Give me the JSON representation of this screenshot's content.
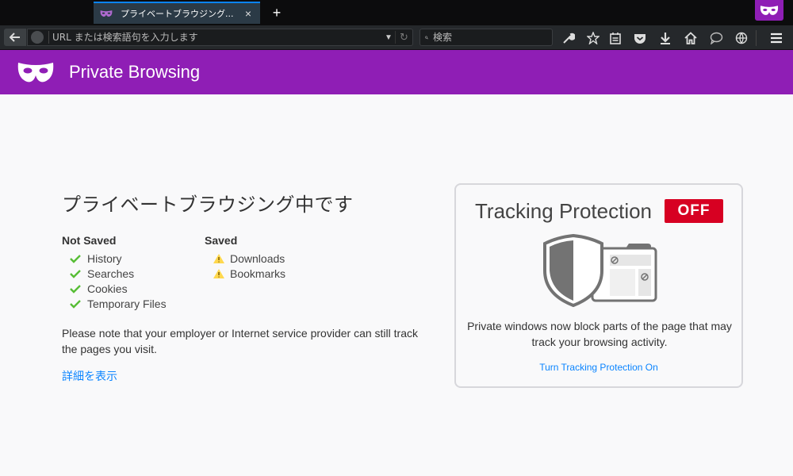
{
  "tab": {
    "title": "プライベートブラウジング...",
    "close_label": "×",
    "newtab_label": "+"
  },
  "navbar": {
    "url_placeholder": "URL または検索語句を入力します",
    "search_placeholder": "検索"
  },
  "header": {
    "title": "Private Browsing"
  },
  "main": {
    "heading": "プライベートブラウジング中です",
    "not_saved": {
      "title": "Not Saved",
      "items": [
        "History",
        "Searches",
        "Cookies",
        "Temporary Files"
      ]
    },
    "saved": {
      "title": "Saved",
      "items": [
        "Downloads",
        "Bookmarks"
      ]
    },
    "note": "Please note that your employer or Internet service provider can still track the pages you visit.",
    "learn_more": "詳細を表示"
  },
  "tracking": {
    "title": "Tracking Protection",
    "status": "OFF",
    "description": "Private windows now block parts of the page that may track your browsing activity.",
    "link": "Turn Tracking Protection On"
  },
  "colors": {
    "accent": "#8f1eb5",
    "link": "#0a84ff",
    "off_badge": "#d70022",
    "check": "#57bd35",
    "warning": "#ffd84e"
  }
}
